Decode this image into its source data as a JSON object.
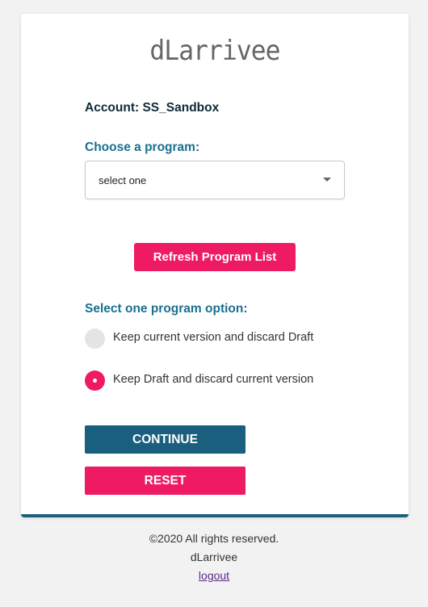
{
  "logo": "dLarrivee",
  "account_label": "Account: SS_Sandbox",
  "program_select": {
    "label": "Choose a program:",
    "selected": "select one"
  },
  "refresh_label": "Refresh Program List",
  "options": {
    "label": "Select one program option:",
    "items": [
      {
        "label": "Keep current version and discard Draft",
        "checked": false
      },
      {
        "label": "Keep Draft and discard current version",
        "checked": true
      }
    ]
  },
  "continue_label": "CONTINUE",
  "reset_label": "RESET",
  "footer": {
    "copyright": "©2020 All rights reserved.",
    "brand": "dLarrivee",
    "logout": "logout"
  },
  "colors": {
    "accent_pink": "#ef1a64",
    "primary_teal": "#1b5f7e",
    "label_teal": "#19708f"
  }
}
